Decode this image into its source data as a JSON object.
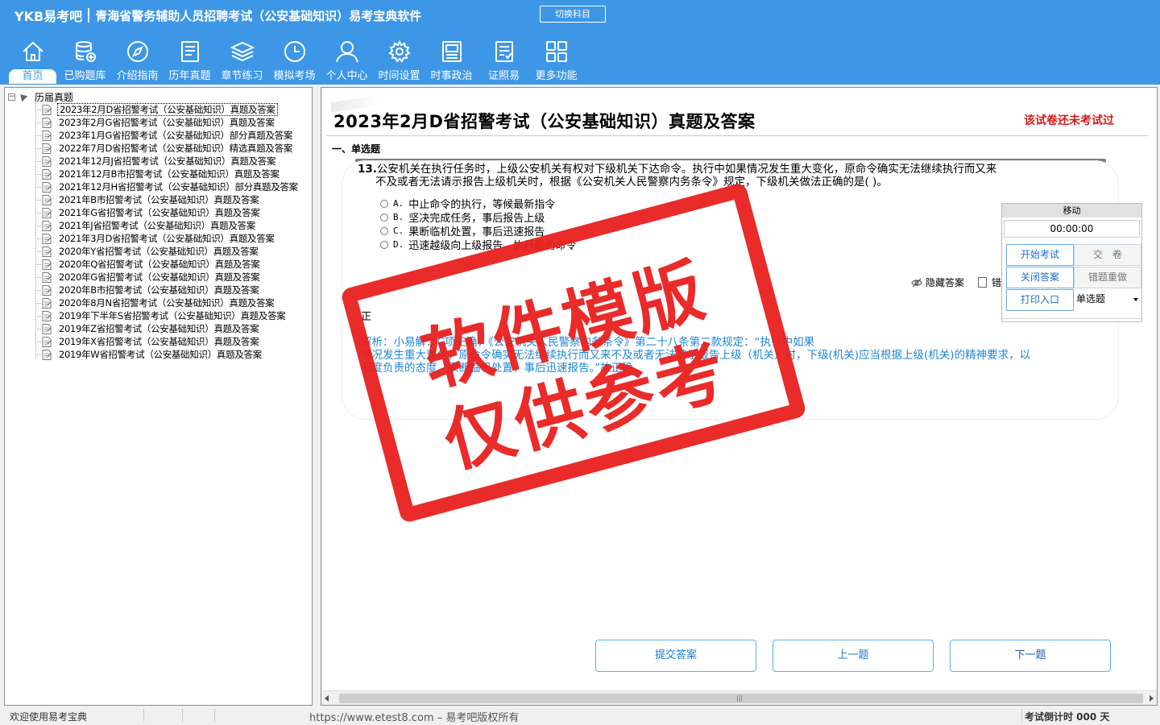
{
  "app": {
    "logo": "YKB易考吧",
    "title": "青海省警务辅助人员招聘考试（公安基础知识）易考宝典软件",
    "switch_subject": "切换科目"
  },
  "nav": [
    {
      "label": "首页",
      "icon": "home-icon"
    },
    {
      "label": "已购题库",
      "icon": "database-icon"
    },
    {
      "label": "介绍指南",
      "icon": "compass-icon"
    },
    {
      "label": "历年真题",
      "icon": "document-list-icon"
    },
    {
      "label": "章节练习",
      "icon": "layers-icon"
    },
    {
      "label": "模拟考场",
      "icon": "clock-icon"
    },
    {
      "label": "个人中心",
      "icon": "user-icon"
    },
    {
      "label": "时间设置",
      "icon": "gear-icon"
    },
    {
      "label": "时事政治",
      "icon": "news-icon"
    },
    {
      "label": "证照易",
      "icon": "certificate-icon"
    },
    {
      "label": "更多功能",
      "icon": "grid-icon"
    }
  ],
  "tree": {
    "root_label": "历届真题",
    "items": [
      "2023年2月D省招警考试（公安基础知识）真题及答案",
      "2023年2月G省招警考试（公安基础知识）真题及答案",
      "2023年1月G省招警考试（公安基础知识）部分真题及答案",
      "2022年7月D省招警考试（公安基础知识）精选真题及答案",
      "2021年12月J省招警考试（公安基础知识）真题及答案",
      "2021年12月B市招警考试（公安基础知识）真题及答案",
      "2021年12月H省招警考试（公安基础知识）部分真题及答案",
      "2021年B市招警考试（公安基础知识）真题及答案",
      "2021年G省招警考试（公安基础知识）真题及答案",
      "2021年J省招警考试（公安基础知识）真题及答案",
      "2021年3月D省招警考试（公安基础知识）真题及答案",
      "2020年Y省招警考试（公安基础知识）真题及答案",
      "2020年Q省招警考试（公安基础知识）真题及答案",
      "2020年G省招警考试（公安基础知识）真题及答案",
      "2020年B市招警考试（公安基础知识）真题及答案",
      "2020年8月N省招警考试（公安基础知识）真题及答案",
      "2019年下半年S省招警考试（公安基础知识）真题及答案",
      "2019年Z省招警考试（公安基础知识）真题及答案",
      "2019年X省招警考试（公安基础知识）真题及答案",
      "2019年W省招警考试（公安基础知识）真题及答案"
    ]
  },
  "paper": {
    "title": "2023年2月D省招警考试（公安基础知识）真题及答案",
    "status": "该试卷还未考试过",
    "section": "一、单选题"
  },
  "question": {
    "number": "13.",
    "text_line1": "公安机关在执行任务时，上级公安机关有权对下级机关下达命令。执行中如果情况发生重大变化，原命令确实无法继续执行而又来",
    "text_line2": "不及或者无法请示报告上级机关时，根据《公安机关人民警察内务条令》规定，下级机关做法正确的是( )。",
    "options": [
      {
        "letter": "A.",
        "text": "中止命令的执行，等候最新指令"
      },
      {
        "letter": "B.",
        "text": "坚决完成任务，事后报告上级"
      },
      {
        "letter": "C.",
        "text": "果断临机处置，事后迅速报告"
      },
      {
        "letter": "D.",
        "text": "迅速越级向上级报告，执行新的命令"
      }
    ],
    "hide_answer": "隐藏答案",
    "mark_wrong": "错",
    "answer_label": "正",
    "analysis_line1": "解析：小易解：C项正确，《公安机关人民警察内务条令》第二十八条第二款规定：“执行中如果",
    "analysis_line2": "情况发生重大变化，原命令确实无法继续执行而又来不及或者无法请示报告上级（机关）时，下级(机关)应当根据上级(机关)的精神要求，以",
    "analysis_line3": "高度负责的态度，果断临机处置，事后迅速报告。”故正确"
  },
  "actions": {
    "submit": "提交答案",
    "prev": "上一题",
    "next": "下一题"
  },
  "timer": {
    "move": "移动",
    "time": "00:00:00",
    "start": "开始考试",
    "hand_in": "交　卷",
    "close_answer": "关闭答案",
    "redo_wrong": "错题重做",
    "print": "打印入口",
    "type": "单选题"
  },
  "watermark": {
    "line1": "软件模版",
    "line2": "仅供参考"
  },
  "status": {
    "welcome": "欢迎使用易考宝典",
    "copyright": "https://www.etest8.com – 易考吧版权所有",
    "countdown": "考试倒计时 000 天"
  },
  "colors": {
    "header_bg": "#3d97e6",
    "status_red": "#d21c1c",
    "analysis_blue": "#1e86d6",
    "stamp_red": "#e8201f"
  }
}
